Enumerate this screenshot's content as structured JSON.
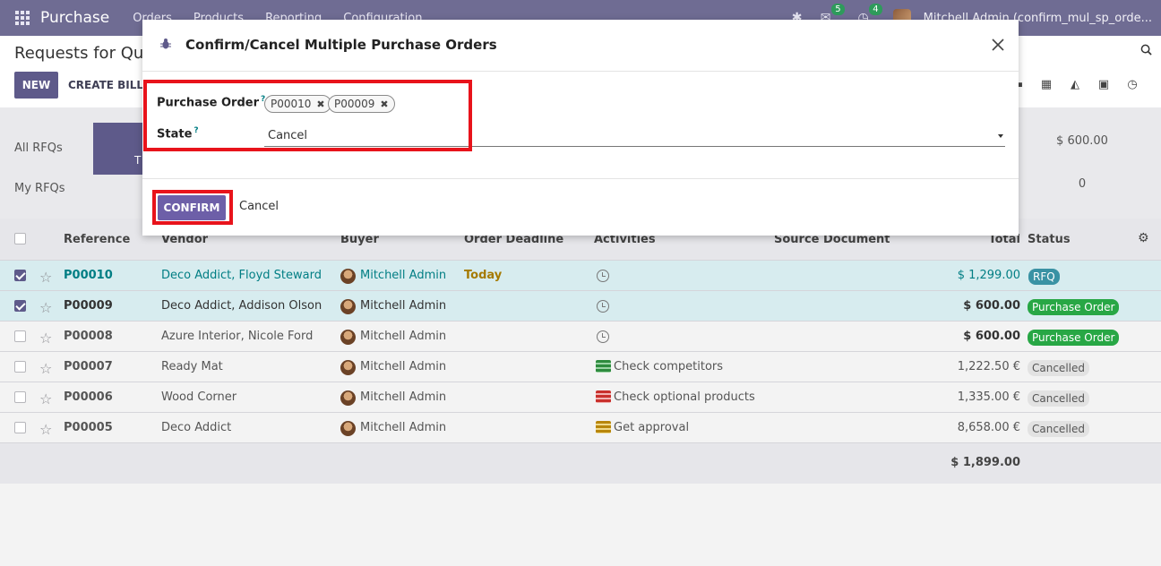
{
  "navbar": {
    "app_name": "Purchase",
    "menu": [
      "Orders",
      "Products",
      "Reporting",
      "Configuration"
    ],
    "messages_count": "5",
    "activities_count": "4",
    "user": "Mitchell Admin (confirm_mul_sp_orde..."
  },
  "control_panel": {
    "breadcrumb": "Requests for Quo",
    "new_label": "NEW",
    "create_bills_label": "CREATE BILLS"
  },
  "dashboard": {
    "row1_label": "All RFQs",
    "row2_label": "My RFQs",
    "tile_text": "T",
    "right_value_1": "$ 600.00",
    "right_value_2": "0"
  },
  "list": {
    "columns": {
      "reference": "Reference",
      "vendor": "Vendor",
      "buyer": "Buyer",
      "order_deadline": "Order Deadline",
      "activities": "Activities",
      "source_document": "Source Document",
      "total": "Total",
      "status": "Status"
    },
    "rows": [
      {
        "ref": "P00010",
        "vendor": "Deco Addict, Floyd Steward",
        "buyer": "Mitchell Admin",
        "deadline": "Today",
        "activity": "",
        "total": "$ 1,299.00",
        "status": "RFQ"
      },
      {
        "ref": "P00009",
        "vendor": "Deco Addict, Addison Olson",
        "buyer": "Mitchell Admin",
        "deadline": "",
        "activity": "",
        "total": "$ 600.00",
        "status": "Purchase Order"
      },
      {
        "ref": "P00008",
        "vendor": "Azure Interior, Nicole Ford",
        "buyer": "Mitchell Admin",
        "deadline": "",
        "activity": "",
        "total": "$ 600.00",
        "status": "Purchase Order"
      },
      {
        "ref": "P00007",
        "vendor": "Ready Mat",
        "buyer": "Mitchell Admin",
        "deadline": "",
        "activity": "Check competitors",
        "total": "1,222.50 €",
        "status": "Cancelled"
      },
      {
        "ref": "P00006",
        "vendor": "Wood Corner",
        "buyer": "Mitchell Admin",
        "deadline": "",
        "activity": "Check optional products",
        "total": "1,335.00 €",
        "status": "Cancelled"
      },
      {
        "ref": "P00005",
        "vendor": "Deco Addict",
        "buyer": "Mitchell Admin",
        "deadline": "",
        "activity": "Get approval",
        "total": "8,658.00 €",
        "status": "Cancelled"
      }
    ],
    "footer_total": "$ 1,899.00"
  },
  "dialog": {
    "title": "Confirm/Cancel Multiple Purchase Orders",
    "purchase_order_label": "Purchase Order",
    "help_mark": "?",
    "tags": [
      "P00010",
      "P00009"
    ],
    "state_label": "State",
    "state_value": "Cancel",
    "confirm_label": "CONFIRM",
    "cancel_label": "Cancel"
  },
  "colors": {
    "navbar": "#6f6c93",
    "primary": "#6d5fa8",
    "highlight": "#e8131b",
    "link": "#017e84"
  }
}
